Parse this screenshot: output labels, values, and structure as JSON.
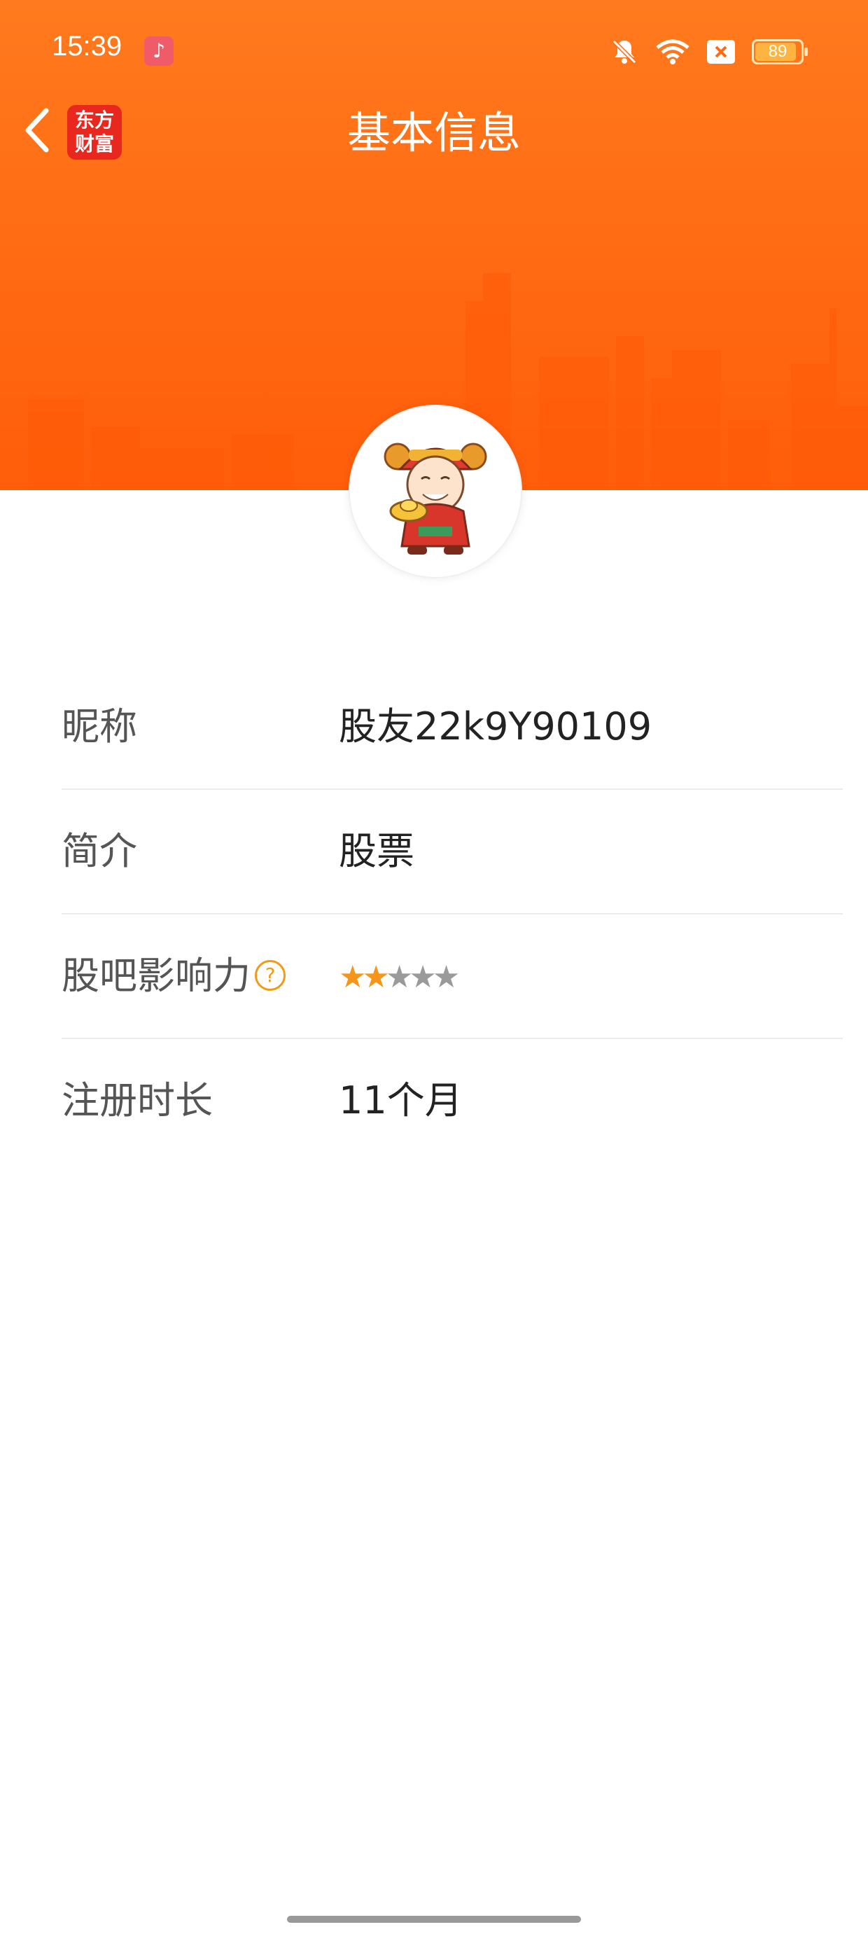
{
  "status_bar": {
    "time": "15:39",
    "app_icon": "music-note-icon",
    "icons": [
      "bell-muted-icon",
      "wifi-icon",
      "sim-x-icon",
      "battery-icon"
    ],
    "battery_level": "89",
    "battery_fraction": 0.89
  },
  "nav": {
    "back_icon": "chevron-left-icon",
    "logo_line1": "东方",
    "logo_line2": "财富",
    "title": "基本信息"
  },
  "colors": {
    "banner": "#ff6a12",
    "accent": "#f5961a",
    "logo": "#e8271f"
  },
  "profile": {
    "avatar": "god-of-wealth-avatar"
  },
  "info": {
    "nickname_label": "昵称",
    "nickname_value": "股友22k9Y90109",
    "intro_label": "简介",
    "intro_value": "股票",
    "influence_label": "股吧影响力",
    "influence_help": "?",
    "influence_stars_filled": 2,
    "influence_stars_total": 5,
    "register_label": "注册时长",
    "register_value": "11个月"
  }
}
